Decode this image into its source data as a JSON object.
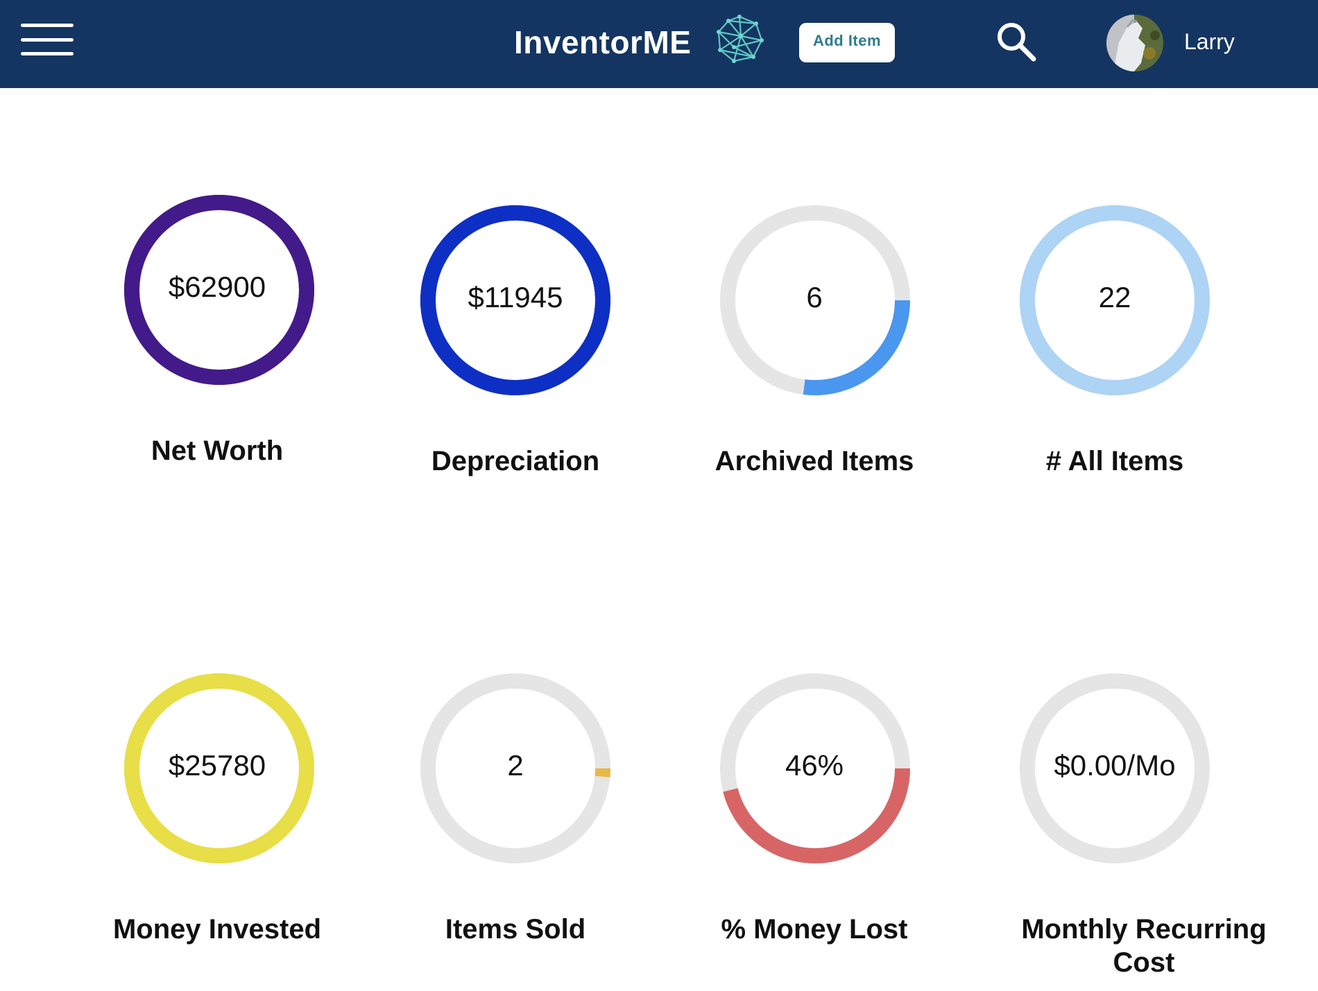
{
  "header": {
    "app_title": "InventorME",
    "add_item_label": "Add Item",
    "user_name": "Larry",
    "colors": {
      "bar": "#143561",
      "accent": "#2e7d8c"
    },
    "icons": {
      "menu": "hamburger-menu-icon",
      "logo": "network-globe-logo",
      "search": "search-icon",
      "avatar": "user-avatar"
    }
  },
  "stats": [
    {
      "value": "$62900",
      "label": "Net Worth",
      "color": "#431a8a",
      "fraction": 1.0
    },
    {
      "value": "$11945",
      "label": "Depreciation",
      "color": "#0e2fc4",
      "fraction": 1.0
    },
    {
      "value": "6",
      "label": "Archived Items",
      "color": "#4a97f0",
      "fraction": 0.27
    },
    {
      "value": "22",
      "label": "# All Items",
      "color": "#add3f5",
      "fraction": 1.0
    },
    {
      "value": "$25780",
      "label": "Money Invested",
      "color": "#e8de47",
      "fraction": 1.0
    },
    {
      "value": "2",
      "label": "Items Sold",
      "color": "#e8b845",
      "fraction": 0.015
    },
    {
      "value": "46%",
      "label": "% Money Lost",
      "color": "#d86565",
      "fraction": 0.46
    },
    {
      "value": "$0.00/Mo",
      "label": "Monthly Recurring Cost",
      "color": "#e5e5e5",
      "fraction": 0.0
    }
  ],
  "track_color": "#e5e5e5"
}
